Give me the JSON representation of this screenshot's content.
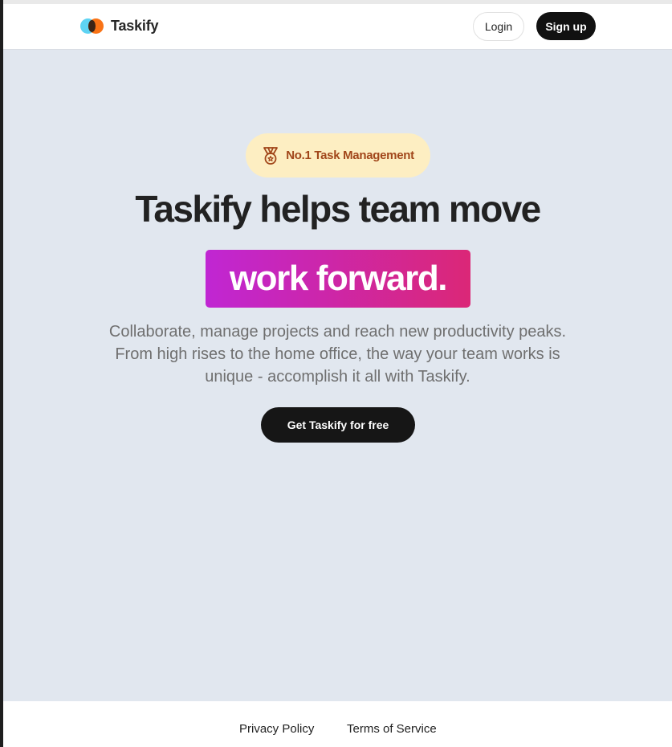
{
  "header": {
    "brand": "Taskify",
    "login_label": "Login",
    "signup_label": "Sign up"
  },
  "hero": {
    "badge_text": "No.1 Task Management",
    "badge_icon": "medal-icon",
    "headline": "Taskify helps team move",
    "highlight": "work forward.",
    "subtitle_lines": [
      "Collaborate, manage projects and reach new productivity peaks.",
      "From high rises to the home office, the way your team works is",
      "unique - accomplish it all with Taskify."
    ],
    "cta_label": "Get Taskify for free"
  },
  "footer": {
    "privacy": "Privacy Policy",
    "terms": "Terms of Service"
  },
  "colors": {
    "hero_bg": "#e1e7ef",
    "badge_bg": "#fdeec2",
    "badge_text": "#a1461a",
    "gradient_start": "#c026d3",
    "gradient_end": "#db2777",
    "button_dark": "#111111"
  }
}
